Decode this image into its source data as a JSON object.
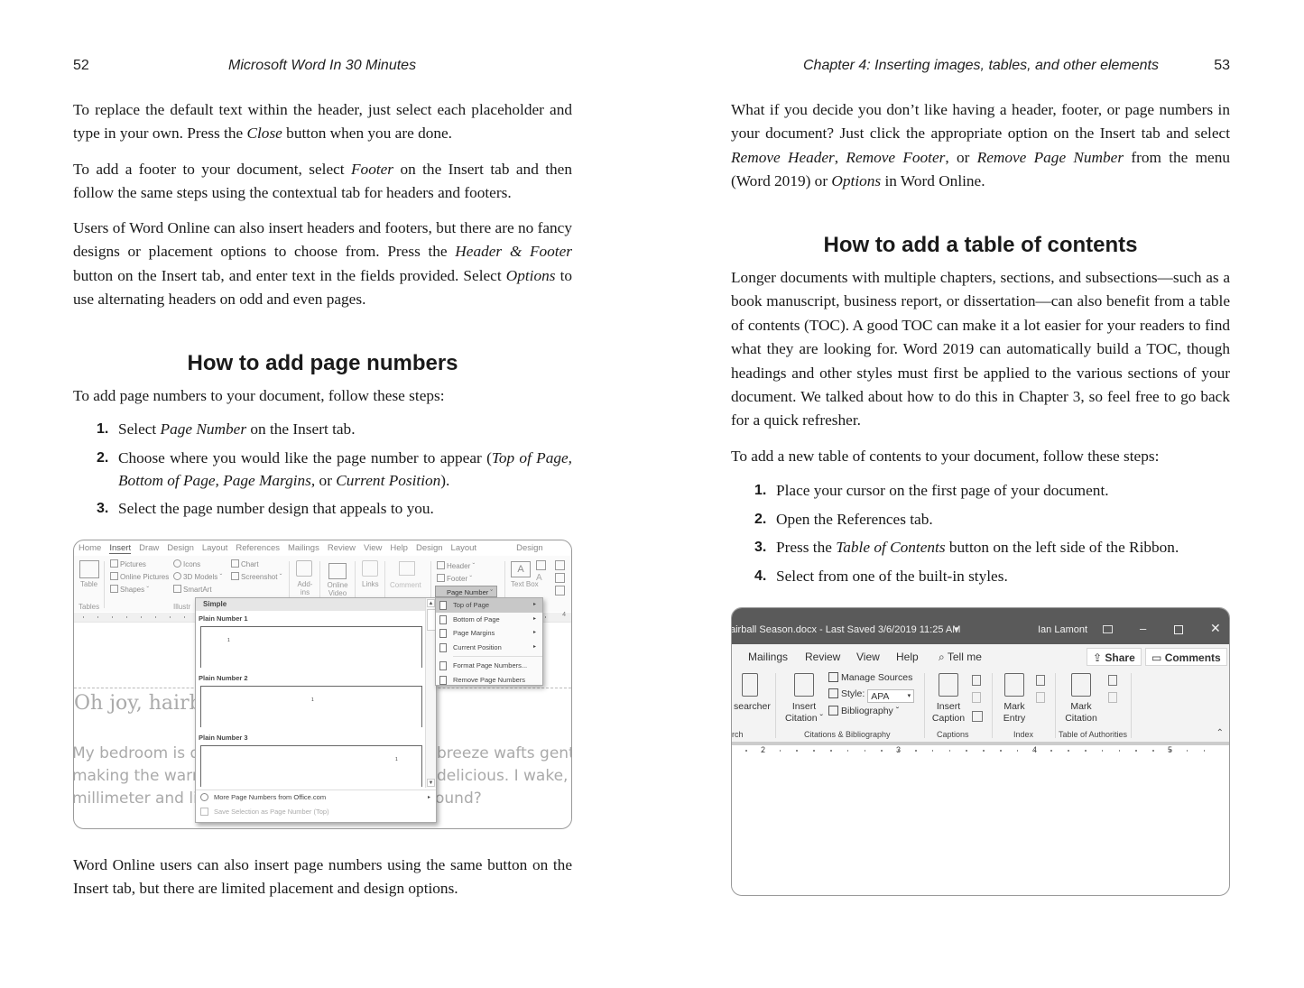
{
  "left_page": {
    "page_number": "52",
    "running_head": "Microsoft Word In 30 Minutes",
    "para1": [
      "To replace the default text within the header, just select each placeholder and type in your own. Press the ",
      "Close",
      " button when you are done."
    ],
    "para2": [
      "To add a footer to your document, select ",
      "Footer",
      " on the Insert tab and then follow the same steps using the contextual tab for headers and footers."
    ],
    "para3": [
      "Users of Word Online can also insert headers and footers, but there are no fancy designs or placement options to choose from. Press the ",
      "Header & Footer",
      " button on the Insert tab, and enter text in the fields provided. Select ",
      "Options",
      " to use alternating headers on odd and even pages."
    ],
    "heading": "How to add page numbers",
    "intro": "To add page numbers to your document, follow these steps:",
    "steps": [
      {
        "num": "1.",
        "parts": [
          "Select ",
          "Page Number",
          " on the Insert tab."
        ]
      },
      {
        "num": "2.",
        "parts": [
          "Choose where you would like the page number to appear (",
          "Top of Page, Bottom of Page, Page Margins,",
          " or ",
          "Current Position",
          ")."
        ]
      },
      {
        "num": "3.",
        "parts": [
          "Select the page number design that appeals to you."
        ]
      }
    ],
    "closing": "Word Online users can also insert page numbers using the same button on the Insert tab, but there are limited placement and design options.",
    "screenshot": {
      "tabs": [
        "Home",
        "Insert",
        "Draw",
        "Design",
        "Layout",
        "References",
        "Mailings",
        "Review",
        "View",
        "Help",
        "Design",
        "Layout",
        "Design"
      ],
      "active_tab": "Insert",
      "table_label": "Table",
      "tables_group": "Tables",
      "illus_group": "Illustr",
      "pictures": "Pictures",
      "online_pictures": "Online Pictures",
      "shapes": "Shapes",
      "icons": "Icons",
      "models_3d": "3D Models",
      "smartart": "SmartArt",
      "chart": "Chart",
      "screenshot": "Screenshot",
      "addins": "Add-ins",
      "online_video": "Online Video",
      "links": "Links",
      "comment": "Comment",
      "header": "Header",
      "footer": "Footer",
      "page_number": "Page Number",
      "text_box": "Text Box",
      "ruler_right": "4",
      "gallery_header": "Simple",
      "gallery_items": [
        "Plain Number 1",
        "Plain Number 2",
        "Plain Number 3"
      ],
      "gallery_page_num": "1",
      "more_from_office": "More Page Numbers from Office.com",
      "save_selection": "Save Selection as Page Number (Top)",
      "menu_items": [
        "Top of Page",
        "Bottom of Page",
        "Page Margins",
        "Current Position"
      ],
      "menu_actions": [
        "Format Page Numbers...",
        "Remove Page Numbers"
      ],
      "doc_title": "Oh joy, hairba",
      "doc_lines": [
        "My bedroom is da",
        "making the warm",
        "millimeter and lis"
      ],
      "doc_lines_right": [
        "breeze wafts gent",
        "delicious. I wake, r",
        "ound?"
      ]
    }
  },
  "right_page": {
    "page_number": "53",
    "running_head": "Chapter 4: Inserting images, tables, and other elements",
    "para1": [
      "What if you decide you don’t like having a header, footer, or page numbers in your document? Just click the appropriate option on the Insert tab and select ",
      "Remove Header",
      ", ",
      "Remove Footer",
      ", or ",
      "Remove Page Number",
      " from the menu (Word 2019) or ",
      "Options",
      " in Word Online."
    ],
    "heading": "How to add a table of contents",
    "para2": "Longer documents with multiple chapters, sections, and subsections—such as a book manuscript, business report, or dissertation—can also benefit from a table of contents (TOC). A good TOC can make it a lot easier for your readers to find what they are looking for. Word 2019 can automatically build a TOC, though headings and other styles must first be applied to the various sections of your document. We talked about how to do this in Chapter 3, so feel free to go back for a quick refresher.",
    "intro": "To add a new table of contents to your document, follow these steps:",
    "steps": [
      {
        "num": "1.",
        "parts": [
          "Place your cursor on the first page of your document."
        ]
      },
      {
        "num": "2.",
        "parts": [
          "Open the References tab."
        ]
      },
      {
        "num": "3.",
        "parts": [
          "Press the ",
          "Table of Contents",
          " button on the left side of the Ribbon."
        ]
      },
      {
        "num": "4.",
        "parts": [
          "Select from one of the built-in styles."
        ]
      }
    ],
    "screenshot": {
      "title": "airball Season.docx  -  Last Saved 3/6/2019 11:25 AM",
      "user": "Ian Lamont",
      "tabs": [
        "Mailings",
        "Review",
        "View",
        "Help"
      ],
      "tell_me": "Tell me",
      "share": "Share",
      "comments": "Comments",
      "researcher": "searcher",
      "research_group": "rch",
      "insert_citation": [
        "Insert",
        "Citation ˇ"
      ],
      "manage_sources": "Manage Sources",
      "style_label": "Style:",
      "style_value": "APA",
      "bibliography": "Bibliography ˇ",
      "citations_group": "Citations & Bibliography",
      "insert_caption": [
        "Insert",
        "Caption"
      ],
      "captions_group": "Captions",
      "mark_entry": [
        "Mark",
        "Entry"
      ],
      "index_group": "Index",
      "mark_citation": [
        "Mark",
        "Citation"
      ],
      "toa_group": "Table of Authorities",
      "ruler_numbers": [
        "2",
        "3",
        "4",
        "5"
      ]
    }
  }
}
